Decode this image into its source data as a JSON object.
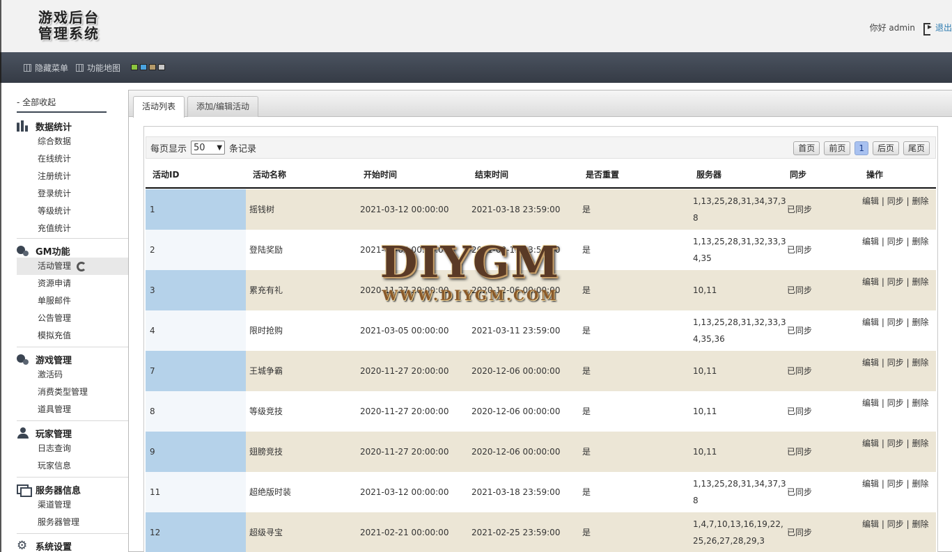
{
  "header": {
    "logo_line1": "游戏后台",
    "logo_line2": "管理系统",
    "greeting": "你好 admin",
    "logout": "退出"
  },
  "topbar": {
    "hide_menu": "隐藏菜单",
    "function_map": "功能地图",
    "theme_colors": [
      "#8cc63f",
      "#4aa3df",
      "#b49a6a",
      "#c8c8c8"
    ]
  },
  "sidebar": {
    "collapse_all": "- 全部收起",
    "groups": [
      {
        "title": "数据统计",
        "icon": "bar-chart-icon",
        "items": [
          "综合数据",
          "在线统计",
          "注册统计",
          "登录统计",
          "等级统计",
          "充值统计"
        ]
      },
      {
        "title": "GM功能",
        "icon": "gears-icon",
        "items": [
          "活动管理",
          "资源申请",
          "单服邮件",
          "公告管理",
          "模拟充值"
        ]
      },
      {
        "title": "游戏管理",
        "icon": "gears-icon",
        "items": [
          "激活码",
          "消费类型管理",
          "道具管理"
        ]
      },
      {
        "title": "玩家管理",
        "icon": "person-icon",
        "items": [
          "日志查询",
          "玩家信息"
        ]
      },
      {
        "title": "服务器信息",
        "icon": "monitor-icon",
        "items": [
          "渠道管理",
          "服务器管理"
        ]
      },
      {
        "title": "系统设置",
        "icon": "gear-icon",
        "items": []
      }
    ]
  },
  "tabs": [
    "活动列表",
    "添加/编辑活动"
  ],
  "toolbar": {
    "per_page_prefix": "每页显示",
    "per_page_value": "50",
    "per_page_suffix": "条记录",
    "pager": [
      "首页",
      "前页",
      "1",
      "后页",
      "尾页"
    ]
  },
  "table": {
    "headers": [
      "活动ID",
      "活动名称",
      "开始时间",
      "结束时间",
      "是否重置",
      "服务器",
      "同步",
      "操作"
    ],
    "rows": [
      {
        "id": "1",
        "name": "摇钱树",
        "start": "2021-03-12 00:00:00",
        "end": "2021-03-18 23:59:00",
        "reset": "是",
        "servers": "1,13,25,28,31,34,37,38",
        "sync": "已同步"
      },
      {
        "id": "2",
        "name": "登陆奖励",
        "start": "2021-03-05 00:00:00",
        "end": "2021-03-11 23:59:00",
        "reset": "是",
        "servers": "1,13,25,28,31,32,33,34,35",
        "sync": "已同步"
      },
      {
        "id": "3",
        "name": "累充有礼",
        "start": "2020-11-27 20:00:00",
        "end": "2020-12-06 00:00:00",
        "reset": "是",
        "servers": "10,11",
        "sync": "已同步"
      },
      {
        "id": "4",
        "name": "限时抢购",
        "start": "2021-03-05 00:00:00",
        "end": "2021-03-11 23:59:00",
        "reset": "是",
        "servers": "1,13,25,28,31,32,33,34,35,36",
        "sync": "已同步"
      },
      {
        "id": "7",
        "name": "王城争霸",
        "start": "2020-11-27 20:00:00",
        "end": "2020-12-06 00:00:00",
        "reset": "是",
        "servers": "10,11",
        "sync": "已同步"
      },
      {
        "id": "8",
        "name": "等级竞技",
        "start": "2020-11-27 20:00:00",
        "end": "2020-12-06 00:00:00",
        "reset": "是",
        "servers": "10,11",
        "sync": "已同步"
      },
      {
        "id": "9",
        "name": "翅膀竞技",
        "start": "2020-11-27 20:00:00",
        "end": "2020-12-06 00:00:00",
        "reset": "是",
        "servers": "10,11",
        "sync": "已同步"
      },
      {
        "id": "11",
        "name": "超绝版时装",
        "start": "2021-03-12 00:00:00",
        "end": "2021-03-18 23:59:00",
        "reset": "是",
        "servers": "1,13,25,28,31,34,37,38",
        "sync": "已同步"
      },
      {
        "id": "12",
        "name": "超级寻宝",
        "start": "2021-02-21 00:00:00",
        "end": "2021-02-25 23:59:00",
        "reset": "是",
        "servers": "1,4,7,10,13,16,19,22,25,26,27,28,29,3",
        "sync": "已同步"
      }
    ],
    "op_edit": "编辑",
    "op_sync": "同步",
    "op_delete": "删除",
    "op_sep": "|"
  },
  "watermark": {
    "main": "DIYGM",
    "sub": "WWW.DIYGM.COM"
  }
}
